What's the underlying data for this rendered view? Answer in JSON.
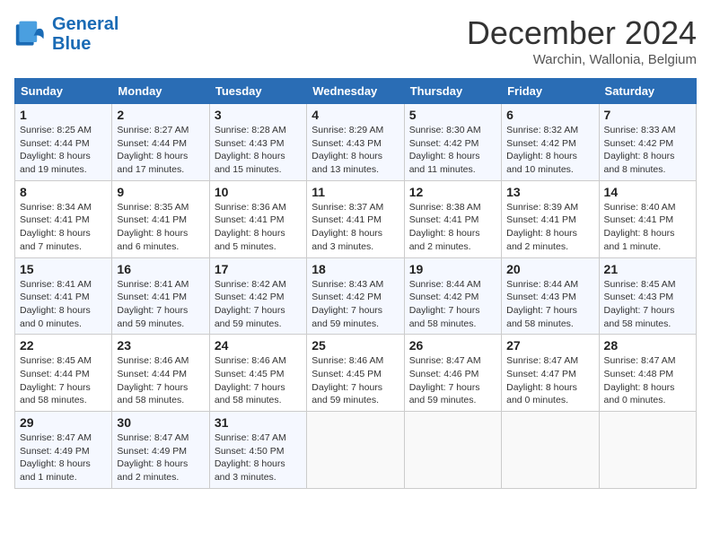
{
  "header": {
    "logo_line1": "General",
    "logo_line2": "Blue",
    "month": "December 2024",
    "location": "Warchin, Wallonia, Belgium"
  },
  "weekdays": [
    "Sunday",
    "Monday",
    "Tuesday",
    "Wednesday",
    "Thursday",
    "Friday",
    "Saturday"
  ],
  "weeks": [
    [
      {
        "day": "1",
        "sunrise": "Sunrise: 8:25 AM",
        "sunset": "Sunset: 4:44 PM",
        "daylight": "Daylight: 8 hours and 19 minutes."
      },
      {
        "day": "2",
        "sunrise": "Sunrise: 8:27 AM",
        "sunset": "Sunset: 4:44 PM",
        "daylight": "Daylight: 8 hours and 17 minutes."
      },
      {
        "day": "3",
        "sunrise": "Sunrise: 8:28 AM",
        "sunset": "Sunset: 4:43 PM",
        "daylight": "Daylight: 8 hours and 15 minutes."
      },
      {
        "day": "4",
        "sunrise": "Sunrise: 8:29 AM",
        "sunset": "Sunset: 4:43 PM",
        "daylight": "Daylight: 8 hours and 13 minutes."
      },
      {
        "day": "5",
        "sunrise": "Sunrise: 8:30 AM",
        "sunset": "Sunset: 4:42 PM",
        "daylight": "Daylight: 8 hours and 11 minutes."
      },
      {
        "day": "6",
        "sunrise": "Sunrise: 8:32 AM",
        "sunset": "Sunset: 4:42 PM",
        "daylight": "Daylight: 8 hours and 10 minutes."
      },
      {
        "day": "7",
        "sunrise": "Sunrise: 8:33 AM",
        "sunset": "Sunset: 4:42 PM",
        "daylight": "Daylight: 8 hours and 8 minutes."
      }
    ],
    [
      {
        "day": "8",
        "sunrise": "Sunrise: 8:34 AM",
        "sunset": "Sunset: 4:41 PM",
        "daylight": "Daylight: 8 hours and 7 minutes."
      },
      {
        "day": "9",
        "sunrise": "Sunrise: 8:35 AM",
        "sunset": "Sunset: 4:41 PM",
        "daylight": "Daylight: 8 hours and 6 minutes."
      },
      {
        "day": "10",
        "sunrise": "Sunrise: 8:36 AM",
        "sunset": "Sunset: 4:41 PM",
        "daylight": "Daylight: 8 hours and 5 minutes."
      },
      {
        "day": "11",
        "sunrise": "Sunrise: 8:37 AM",
        "sunset": "Sunset: 4:41 PM",
        "daylight": "Daylight: 8 hours and 3 minutes."
      },
      {
        "day": "12",
        "sunrise": "Sunrise: 8:38 AM",
        "sunset": "Sunset: 4:41 PM",
        "daylight": "Daylight: 8 hours and 2 minutes."
      },
      {
        "day": "13",
        "sunrise": "Sunrise: 8:39 AM",
        "sunset": "Sunset: 4:41 PM",
        "daylight": "Daylight: 8 hours and 2 minutes."
      },
      {
        "day": "14",
        "sunrise": "Sunrise: 8:40 AM",
        "sunset": "Sunset: 4:41 PM",
        "daylight": "Daylight: 8 hours and 1 minute."
      }
    ],
    [
      {
        "day": "15",
        "sunrise": "Sunrise: 8:41 AM",
        "sunset": "Sunset: 4:41 PM",
        "daylight": "Daylight: 8 hours and 0 minutes."
      },
      {
        "day": "16",
        "sunrise": "Sunrise: 8:41 AM",
        "sunset": "Sunset: 4:41 PM",
        "daylight": "Daylight: 7 hours and 59 minutes."
      },
      {
        "day": "17",
        "sunrise": "Sunrise: 8:42 AM",
        "sunset": "Sunset: 4:42 PM",
        "daylight": "Daylight: 7 hours and 59 minutes."
      },
      {
        "day": "18",
        "sunrise": "Sunrise: 8:43 AM",
        "sunset": "Sunset: 4:42 PM",
        "daylight": "Daylight: 7 hours and 59 minutes."
      },
      {
        "day": "19",
        "sunrise": "Sunrise: 8:44 AM",
        "sunset": "Sunset: 4:42 PM",
        "daylight": "Daylight: 7 hours and 58 minutes."
      },
      {
        "day": "20",
        "sunrise": "Sunrise: 8:44 AM",
        "sunset": "Sunset: 4:43 PM",
        "daylight": "Daylight: 7 hours and 58 minutes."
      },
      {
        "day": "21",
        "sunrise": "Sunrise: 8:45 AM",
        "sunset": "Sunset: 4:43 PM",
        "daylight": "Daylight: 7 hours and 58 minutes."
      }
    ],
    [
      {
        "day": "22",
        "sunrise": "Sunrise: 8:45 AM",
        "sunset": "Sunset: 4:44 PM",
        "daylight": "Daylight: 7 hours and 58 minutes."
      },
      {
        "day": "23",
        "sunrise": "Sunrise: 8:46 AM",
        "sunset": "Sunset: 4:44 PM",
        "daylight": "Daylight: 7 hours and 58 minutes."
      },
      {
        "day": "24",
        "sunrise": "Sunrise: 8:46 AM",
        "sunset": "Sunset: 4:45 PM",
        "daylight": "Daylight: 7 hours and 58 minutes."
      },
      {
        "day": "25",
        "sunrise": "Sunrise: 8:46 AM",
        "sunset": "Sunset: 4:45 PM",
        "daylight": "Daylight: 7 hours and 59 minutes."
      },
      {
        "day": "26",
        "sunrise": "Sunrise: 8:47 AM",
        "sunset": "Sunset: 4:46 PM",
        "daylight": "Daylight: 7 hours and 59 minutes."
      },
      {
        "day": "27",
        "sunrise": "Sunrise: 8:47 AM",
        "sunset": "Sunset: 4:47 PM",
        "daylight": "Daylight: 8 hours and 0 minutes."
      },
      {
        "day": "28",
        "sunrise": "Sunrise: 8:47 AM",
        "sunset": "Sunset: 4:48 PM",
        "daylight": "Daylight: 8 hours and 0 minutes."
      }
    ],
    [
      {
        "day": "29",
        "sunrise": "Sunrise: 8:47 AM",
        "sunset": "Sunset: 4:49 PM",
        "daylight": "Daylight: 8 hours and 1 minute."
      },
      {
        "day": "30",
        "sunrise": "Sunrise: 8:47 AM",
        "sunset": "Sunset: 4:49 PM",
        "daylight": "Daylight: 8 hours and 2 minutes."
      },
      {
        "day": "31",
        "sunrise": "Sunrise: 8:47 AM",
        "sunset": "Sunset: 4:50 PM",
        "daylight": "Daylight: 8 hours and 3 minutes."
      },
      null,
      null,
      null,
      null
    ]
  ]
}
